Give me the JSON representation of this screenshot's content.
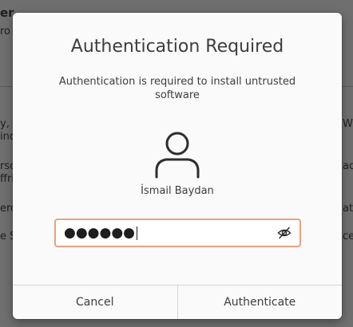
{
  "background": {
    "fragments_left": [
      "er",
      "ro",
      "y, f",
      "incl",
      "rso",
      "ffri",
      "ero",
      "e Sc"
    ],
    "fragments_right": [
      "Wi",
      "ac",
      "ate",
      "ce"
    ]
  },
  "dialog": {
    "title": "Authentication Required",
    "message": "Authentication is required to install untrusted software",
    "user_icon": "user-avatar-icon",
    "username": "İsmail Baydan",
    "password": {
      "masked_value": "●●●●●●",
      "reveal_icon": "eye-slash-icon"
    },
    "cancel_label": "Cancel",
    "authenticate_label": "Authenticate"
  },
  "colors": {
    "dialog_bg": "#fafafa",
    "backdrop": "#6f6f6f",
    "focus_border": "#e9a27f",
    "text": "#3d3d3d"
  }
}
